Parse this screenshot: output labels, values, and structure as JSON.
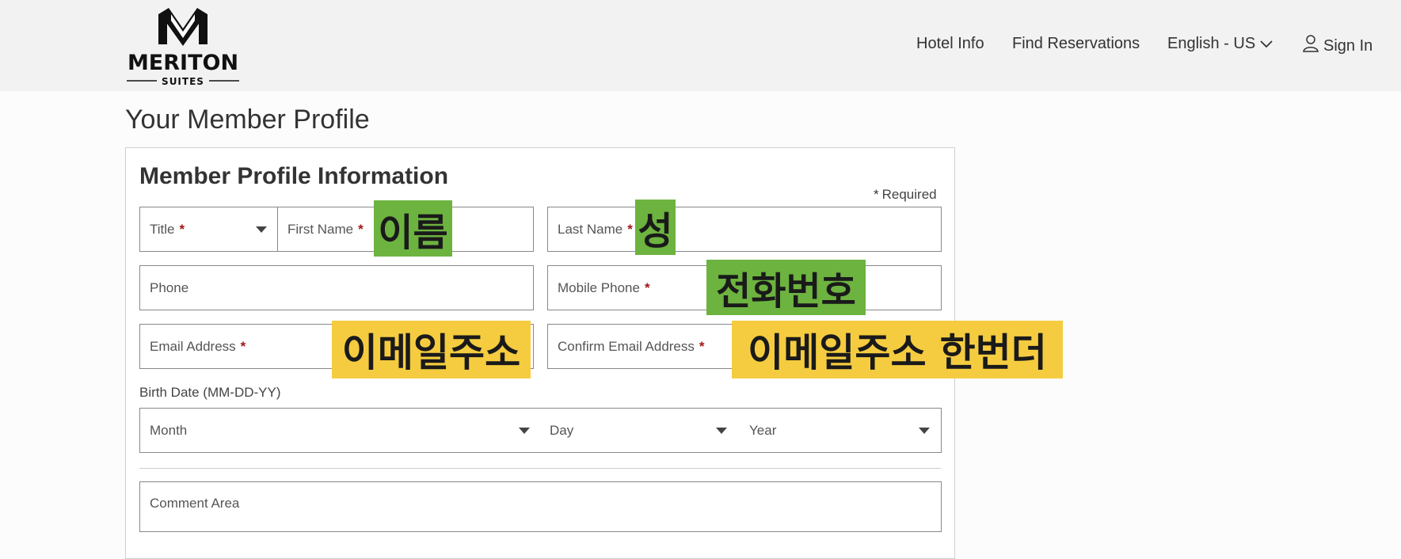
{
  "header": {
    "logo_text": "MERITON",
    "logo_subtext": "SUITES",
    "nav": {
      "hotel_info": "Hotel Info",
      "find_reservations": "Find Reservations",
      "language": "English - US",
      "sign_in": "Sign In"
    }
  },
  "page": {
    "title": "Your Member Profile"
  },
  "form": {
    "section_title": "Member Profile Information",
    "required_note": "Required",
    "required_star": "*",
    "fields": {
      "title": "Title",
      "first_name": "First Name",
      "last_name": "Last Name",
      "phone": "Phone",
      "mobile_phone": "Mobile Phone",
      "email": "Email Address",
      "confirm_email": "Confirm Email Address",
      "birth_label": "Birth Date (MM-DD-YY)",
      "month": "Month",
      "day": "Day",
      "year": "Year",
      "comment": "Comment Area"
    }
  },
  "annotations": {
    "first_name": "이름",
    "last_name": "성",
    "mobile_phone": "전화번호",
    "email": "이메일주소",
    "confirm_email": "이메일주소 한번더"
  },
  "colors": {
    "annotation_green": "#6db33f",
    "annotation_yellow": "#f5cc3f",
    "required_star": "#a31616"
  }
}
